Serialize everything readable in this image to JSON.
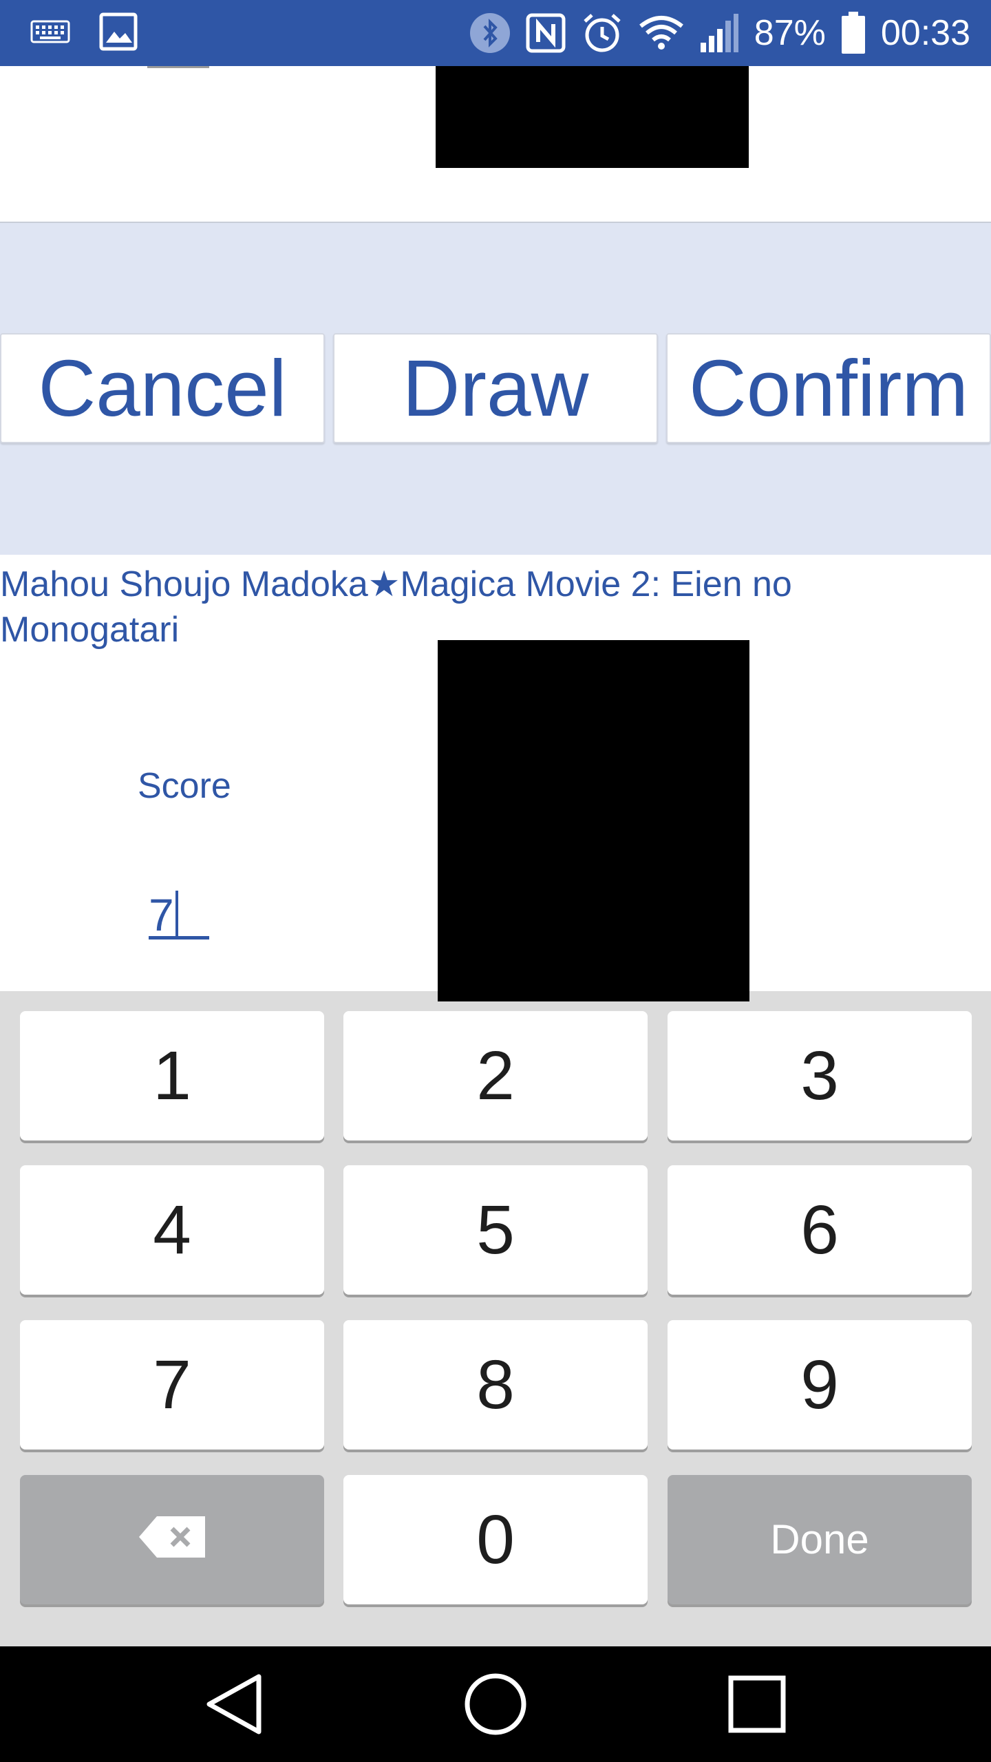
{
  "status_bar": {
    "battery_percent": "87%",
    "time": "00:33",
    "left_icons": [
      "keyboard-icon",
      "image-icon"
    ],
    "right_icons": [
      "bluetooth-icon",
      "nfc-icon",
      "alarm-icon",
      "wifi-icon",
      "signal-icon",
      "battery-icon"
    ]
  },
  "actions": {
    "cancel_label": "Cancel",
    "draw_label": "Draw",
    "confirm_label": "Confirm"
  },
  "entry": {
    "title": "Mahou Shoujo Madoka★Magica Movie 2: Eien no Monogatari",
    "score_label": "Score",
    "score_value": "7"
  },
  "keypad": {
    "keys": [
      "1",
      "2",
      "3",
      "4",
      "5",
      "6",
      "7",
      "8",
      "9",
      "0"
    ],
    "done_label": "Done",
    "backspace_icon": "backspace-icon"
  },
  "nav_bar": {
    "icons": [
      "back-icon",
      "home-icon",
      "recents-icon"
    ]
  },
  "colors": {
    "primary": "#2f56a6",
    "background": "#dfe5f3",
    "keypad_background": "#dcdcdc",
    "key_gray": "#a9aaac"
  }
}
